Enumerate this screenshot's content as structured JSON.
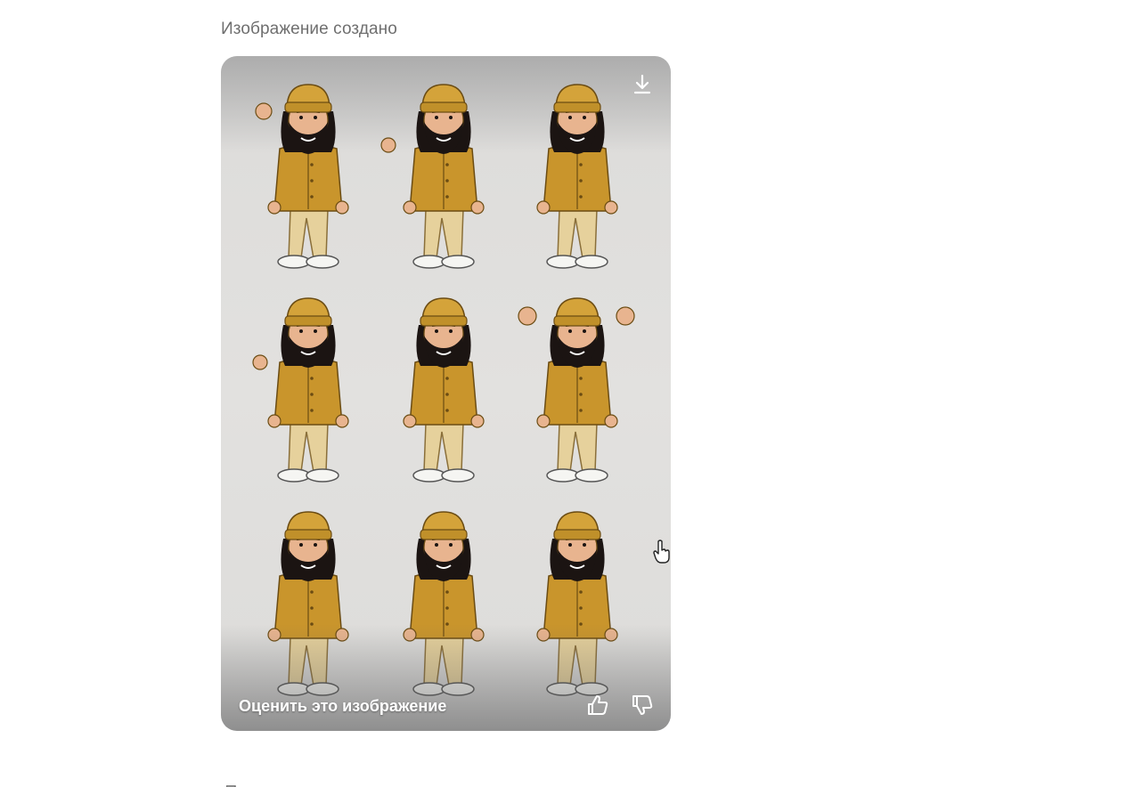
{
  "message": {
    "status": "Изображение создано"
  },
  "image": {
    "alt": "Набор из девяти поз мультяшного бородатого персонажа в горчичной шапке и куртке",
    "download_icon": "download-icon",
    "rate_label": "Оценить это изображение",
    "like_icon": "thumbs-up-icon",
    "dislike_icon": "thumbs-down-icon"
  },
  "colors": {
    "card_bg": "#e2e1df",
    "hat": "#d4a33a",
    "jacket": "#c9952c",
    "pants": "#e6d19c",
    "skin": "#e8b48f",
    "beard": "#1b1412",
    "shoe": "#f5f5f2"
  }
}
